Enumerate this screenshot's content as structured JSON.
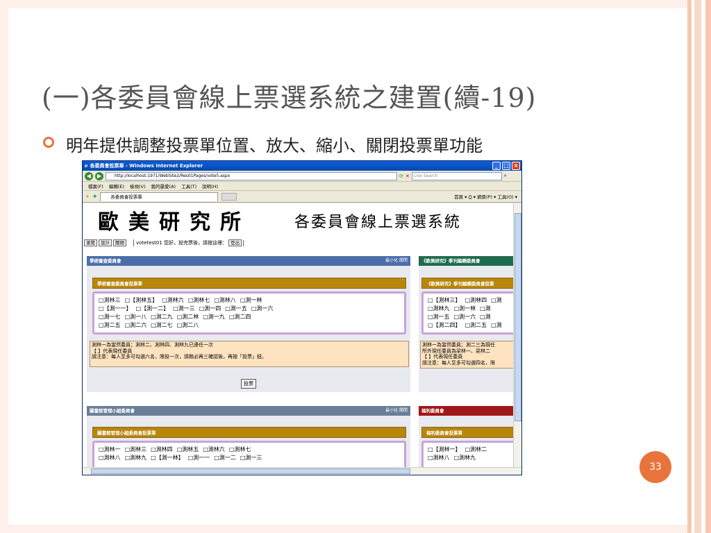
{
  "slide": {
    "title": "(一)各委員會線上票選系統之建置(續-19)",
    "bullet": "明年提供調整投票單位置、放大、縮小、關閉投票單功能",
    "page_number": "33",
    "colors": {
      "accent": "#e8743b",
      "border": "#fdf0ea"
    }
  },
  "browser": {
    "title": "各委員會投票單 - Windows Internet Explorer",
    "url": "http://localhost:1971/WebSite2/Res01Pages/vote5.aspx",
    "search_placeholder": "Live Search",
    "menu": [
      "檔案(F)",
      "編輯(E)",
      "檢視(V)",
      "我的最愛(A)",
      "工具(T)",
      "說明(H)"
    ],
    "tab_label": "各委員會投票單",
    "tab_tools": "首頁 ▾  ⎙ ▾  網頁(P) ▾  工具(O) ▾"
  },
  "site": {
    "logo": "歐美研究所",
    "subtitle": "各委員會線上票選系統",
    "buttons": [
      "瀏覽",
      "設計",
      "關閉"
    ],
    "welcome": "votetest01 您好，投完票後，請按這裡：",
    "logout": "登出"
  },
  "panels": {
    "academic": {
      "header": "學術審查委員會",
      "controls": "最小化 關閉",
      "ballot_title": "學術審查委員會投票單",
      "rows": [
        [
          "□測林三",
          "□【測林五】",
          "□測林六",
          "□測林七",
          "□測林八",
          "□測一林"
        ],
        [
          "□【測一一】",
          "□【測一二】",
          "□測一三",
          "□測一四",
          "□測一五",
          "□測一六"
        ],
        [
          "□測一七",
          "□測一八",
          "□測二九",
          "□測二林",
          "□測一九",
          "□測二四"
        ],
        [
          "□測二五",
          "□測二六",
          "□測二七",
          "□測二八"
        ]
      ],
      "notes": [
        "測林一為當然委員；測林二、測林四、測林九已連任一次",
        "【 】代表現任委員",
        "請注意：每人至多可勾選六名，限投一次，請務必再三確認後，再按「投票」鈕。"
      ],
      "vote_button": "投票"
    },
    "journal": {
      "header": "《歐美研究》季刊編輯委員會",
      "ballot_title": "《歐美研究》季刊編輯委員會投票",
      "rows": [
        [
          "□【測林三】",
          "□測林四",
          "□測"
        ],
        [
          "□測林九",
          "□測一林",
          "□測"
        ],
        [
          "□測一五",
          "□測一六",
          "□測"
        ],
        [
          "□【測二四】",
          "□測二五",
          "□測"
        ]
      ],
      "notes": [
        "測林一為當然委員；測二三為現任",
        "所外現任委員為梁林一、梁林二",
        "【 】代表現任委員",
        "請注意：每人至多可勾選四名，限"
      ]
    },
    "library": {
      "header": "圖書館管理小組委員會",
      "controls": "最小化 關閉",
      "ballot_title": "圖書館管理小組委員會投票單",
      "rows": [
        [
          "□測林一",
          "□測林三",
          "□測林四",
          "□測林五",
          "□測林六",
          "□測林七"
        ],
        [
          "□測林八",
          "□測林九",
          "□【測一林】",
          "□測一一",
          "□測一二",
          "□測一三"
        ]
      ]
    },
    "welfare": {
      "header": "福利委員會",
      "ballot_title": "福利委員會投票單",
      "rows": [
        [
          "□【測林一】",
          "□測林二"
        ],
        [
          "□測林八",
          "□測林九"
        ]
      ]
    }
  }
}
